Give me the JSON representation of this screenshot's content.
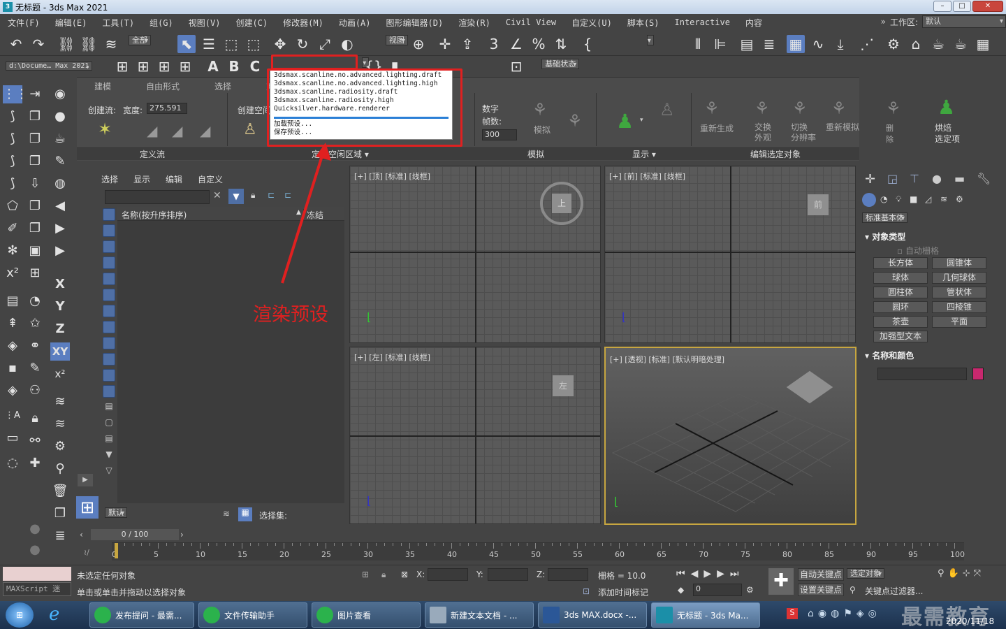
{
  "window": {
    "title": "无标题 - 3ds Max 2021",
    "logo": "3"
  },
  "menu": [
    "文件(F)",
    "编辑(E)",
    "工具(T)",
    "组(G)",
    "视图(V)",
    "创建(C)",
    "修改器(M)",
    "动画(A)",
    "图形编辑器(D)",
    "渲染(R)",
    "Civil View",
    "自定义(U)",
    "脚本(S)",
    "Interactive",
    "内容"
  ],
  "workspace": {
    "label": "工作区:",
    "value": "默认"
  },
  "toolbar": {
    "selection_filter": "全部",
    "coord_system": "视图",
    "render_preset_dropdown": "",
    "state_set": "基础状态",
    "project_path": "d:\\Docume… Max 2021"
  },
  "render_presets": {
    "items": [
      "3dsmax.scanline.no.advanced.lighting.draft",
      "3dsmax.scanline.no.advanced.lighting.high",
      "3dsmax.scanline.radiosity.draft",
      "3dsmax.scanline.radiosity.high",
      "Quicksilver.hardware.renderer"
    ],
    "load": "加载预设...",
    "save": "保存预设..."
  },
  "annotation": {
    "text": "渲染预设",
    "color": "#e02020"
  },
  "ribbon": {
    "tabs": [
      "建模",
      "自由形式",
      "选择",
      "对"
    ],
    "create_flow": "创建流:",
    "width_label": "宽度:",
    "width_value": "275.591",
    "create_space": "创建空间",
    "numbers_label": "数字",
    "frames_label": "帧数:",
    "frames_value": "300",
    "simulate": "模拟",
    "regenerate": "重新生成",
    "swap_appearance": "交换\n外观",
    "switch_resolution": "切换\n分辨率",
    "resimulate": "重新模拟",
    "delete": "删除",
    "bake_selection": "烘焙\n选定项",
    "foot_define_flow": "定义流",
    "foot_define_space": "定义空闲区域 ▾",
    "foot_simulate": "模拟",
    "foot_display": "显示 ▾",
    "foot_edit_selected": "编辑选定对象"
  },
  "scene_explorer": {
    "tabs": [
      "选择",
      "显示",
      "编辑",
      "自定义"
    ],
    "col_name": "名称(按升序排序)",
    "col_freeze": "冻结",
    "layer": "默认",
    "selection_set": "选择集:"
  },
  "viewports": [
    {
      "label": "[+] [顶] [标准] [线框]"
    },
    {
      "label": "[+] [前] [标准] [线框]"
    },
    {
      "label": "[+] [左] [标准] [线框]"
    },
    {
      "label": "[+] [透视] [标准] [默认明暗处理]"
    }
  ],
  "command_panel": {
    "category": "标准基本体",
    "object_type": "对象类型",
    "auto_grid": "自动栅格",
    "buttons": [
      "长方体",
      "圆锥体",
      "球体",
      "几何球体",
      "圆柱体",
      "管状体",
      "圆环",
      "四棱锥",
      "茶壶",
      "平面",
      "加强型文本"
    ],
    "name_color": "名称和颜色",
    "object_color": "#c8286e"
  },
  "timeline": {
    "frame": "0 / 100",
    "ticks": [
      "0",
      "5",
      "10",
      "15",
      "20",
      "25",
      "30",
      "35",
      "40",
      "45",
      "50",
      "55",
      "60",
      "65",
      "70",
      "75",
      "80",
      "85",
      "90",
      "95",
      "100"
    ]
  },
  "status": {
    "maxscript": "MAXScript 迷",
    "line1": "未选定任何对象",
    "line2": "单击或单击并拖动以选择对象",
    "x_label": "X:",
    "y_label": "Y:",
    "z_label": "Z:",
    "grid": "栅格 = 10.0",
    "add_time_tag": "添加时间标记",
    "auto_key": "自动关键点",
    "selected": "选定对象",
    "set_key": "设置关键点",
    "key_filter": "关键点过滤器...",
    "frame_value": "0"
  },
  "taskbar": {
    "items": [
      "发布提问 - 最需...",
      "文件传输助手",
      "图片查看",
      "新建文本文档 - ...",
      "3ds MAX.docx -...",
      "无标题 - 3ds Ma..."
    ],
    "date": "2020/11/18",
    "watermark": "最需教育"
  }
}
